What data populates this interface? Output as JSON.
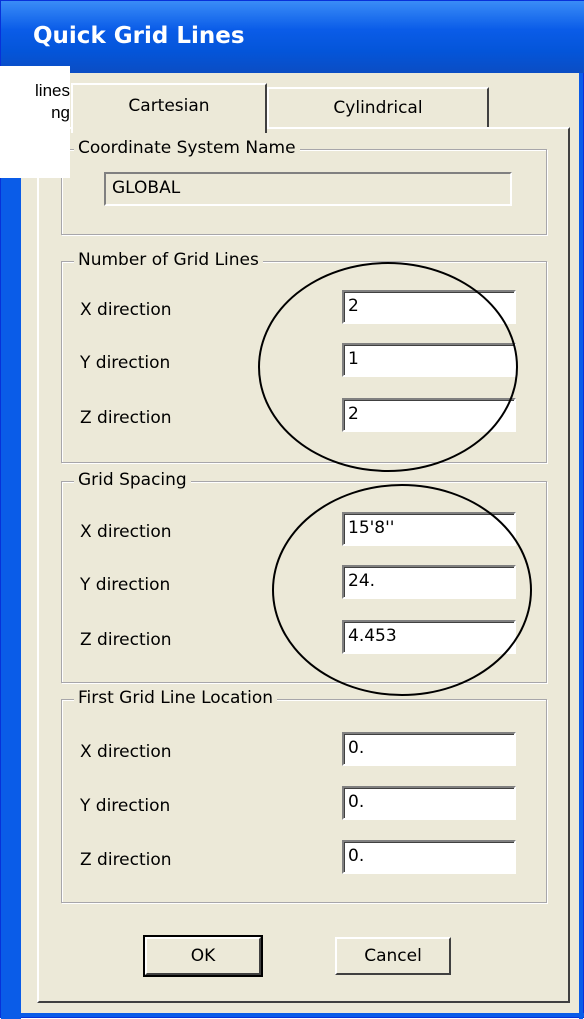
{
  "window": {
    "title": "Quick Grid Lines"
  },
  "overlay": {
    "line1": "Grid lines",
    "line2": "Spacing",
    "display1": "lines",
    "display2": "ng"
  },
  "tabs": [
    {
      "label": "Cartesian",
      "active": true
    },
    {
      "label": "Cylindrical",
      "active": false
    }
  ],
  "coordinate_system": {
    "group_label": "Coordinate System Name",
    "value": "GLOBAL"
  },
  "number_of_grid_lines": {
    "group_label": "Number of Grid Lines",
    "rows": [
      {
        "label": "X direction",
        "value": "2"
      },
      {
        "label": "Y direction",
        "value": "1"
      },
      {
        "label": "Z direction",
        "value": "2"
      }
    ]
  },
  "grid_spacing": {
    "group_label": "Grid Spacing",
    "rows": [
      {
        "label": "X direction",
        "value": "15'8''"
      },
      {
        "label": "Y direction",
        "value": "24."
      },
      {
        "label": "Z direction",
        "value": "4.453"
      }
    ]
  },
  "first_grid_line_location": {
    "group_label": "First Grid Line Location",
    "rows": [
      {
        "label": "X direction",
        "value": "0."
      },
      {
        "label": "Y direction",
        "value": "0."
      },
      {
        "label": "Z direction",
        "value": "0."
      }
    ]
  },
  "buttons": {
    "ok": "OK",
    "cancel": "Cancel"
  },
  "colors": {
    "titlebar": "#0a5ce8",
    "dialog_bg": "#ece9d8",
    "title_text": "#ffffff"
  }
}
